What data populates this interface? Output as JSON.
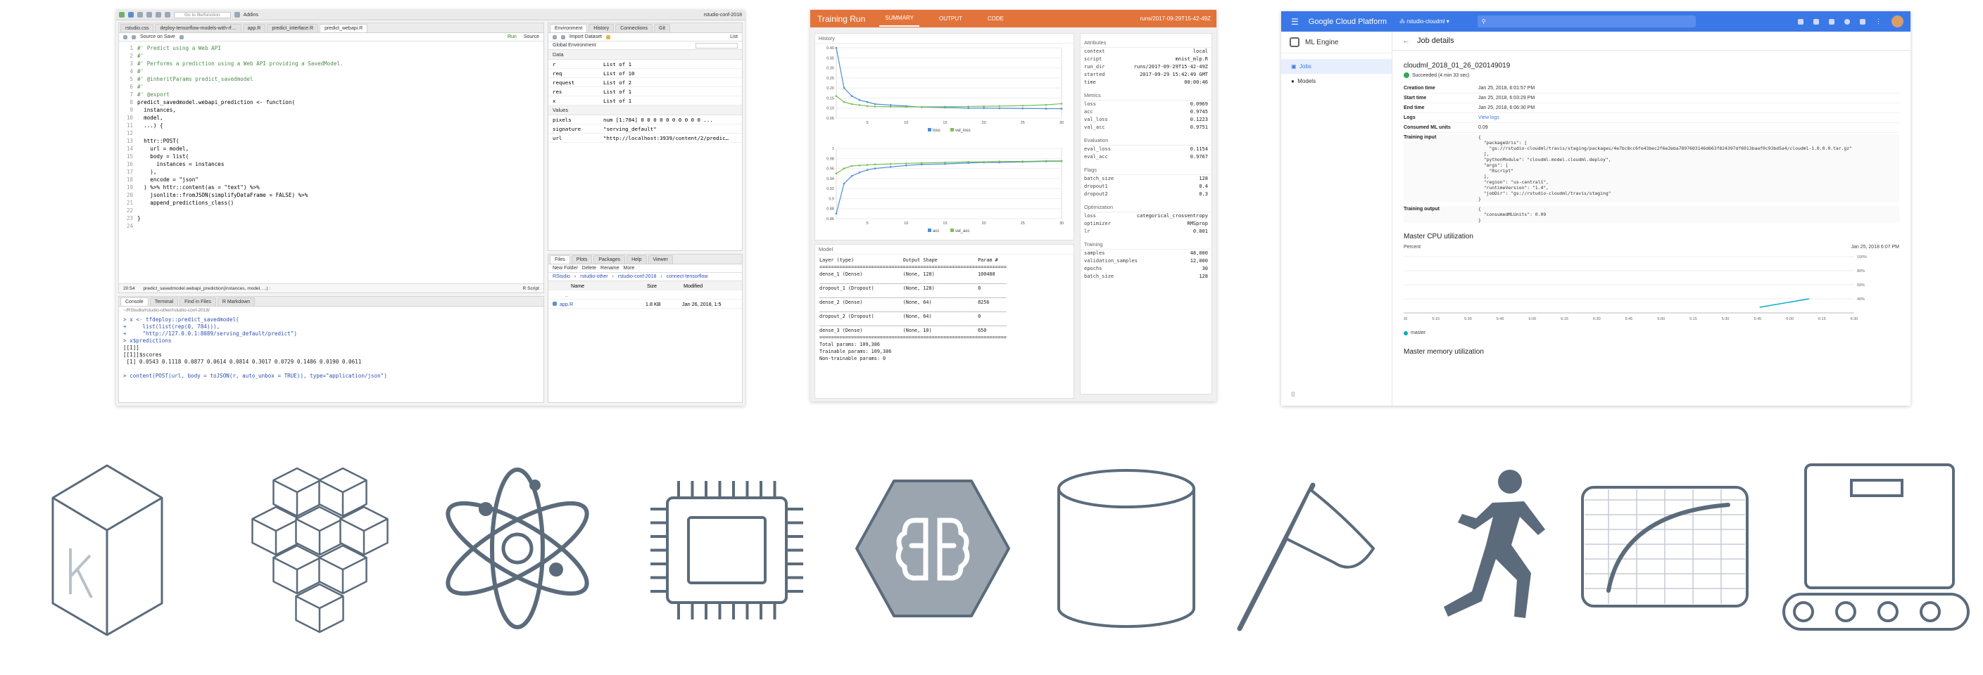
{
  "rstudio": {
    "toolbar": {
      "go_to_file": "Go to file/function",
      "addins": "Addins",
      "project": "rstudio-conf-2018"
    },
    "tabs": [
      "rstudio.css",
      "deploy-tensorflow-models-with-rf…",
      "app.R",
      "predict_interface.R",
      "predict_webapi.R"
    ],
    "source_on_save": "Source on Save",
    "run": "Run",
    "source": "Source",
    "code_lines": [
      [
        "1",
        "#' Predict using a Web API",
        "cm"
      ],
      [
        "2",
        "#'",
        "cm"
      ],
      [
        "3",
        "#' Performs a prediction using a Web API providing a SavedModel.",
        "cm"
      ],
      [
        "4",
        "#'",
        "cm"
      ],
      [
        "5",
        "#' @inheritParams predict_savedmodel",
        "cm"
      ],
      [
        "6",
        "#'",
        "cm"
      ],
      [
        "7",
        "#' @export",
        "cm"
      ],
      [
        "8",
        "predict_savedmodel.webapi_prediction <- function(",
        ""
      ],
      [
        "9",
        "  instances,",
        ""
      ],
      [
        "10",
        "  model,",
        ""
      ],
      [
        "11",
        "  ...) {",
        ""
      ],
      [
        "12",
        "",
        ""
      ],
      [
        "13",
        "  httr::POST(",
        ""
      ],
      [
        "14",
        "    url = model,",
        ""
      ],
      [
        "15",
        "    body = list(",
        ""
      ],
      [
        "16",
        "      instances = instances",
        ""
      ],
      [
        "17",
        "    ),",
        ""
      ],
      [
        "18",
        "    encode = \"json\"",
        ""
      ],
      [
        "19",
        "  ) %>% httr::content(as = \"text\") %>%",
        ""
      ],
      [
        "20",
        "    jsonlite::fromJSON(simplifyDataFrame = FALSE) %>%",
        ""
      ],
      [
        "21",
        "    append_predictions_class()",
        ""
      ],
      [
        "22",
        "",
        ""
      ],
      [
        "23",
        "}",
        ""
      ],
      [
        "24",
        "",
        ""
      ]
    ],
    "status_pos": "20:54",
    "status_fn": "predict_savedmodel.webapi_prediction(instances, model, ...) :",
    "status_lang": "R Script",
    "console_tabs": [
      "Console",
      "Terminal",
      "Find in Files",
      "R Markdown"
    ],
    "console_path": "~/RStudio/rstudio-other/rstudio-conf-2018/",
    "console_lines": [
      [
        "> ",
        "x <- tfdeploy::predict_savedmodel("
      ],
      [
        "+ ",
        "    list(list(rep(0, 784))),"
      ],
      [
        "+ ",
        "    \"http://127.0.0.1:8089/serving_default/predict\")"
      ],
      [
        "> ",
        "x$predictions"
      ],
      [
        "",
        "[[1]]"
      ],
      [
        "",
        "[[1]]$scores"
      ],
      [
        "",
        " [1] 0.0543 0.1118 0.0877 0.0614 0.0814 0.3017 0.0729 0.1486 0.0190 0.0611"
      ],
      [
        "",
        ""
      ],
      [
        "> ",
        "content(POST(url, body = toJSON(r, auto_unbox = TRUE)), type=\"application/json\")"
      ]
    ],
    "env_tabs": [
      "Environment",
      "History",
      "Connections",
      "Git"
    ],
    "import_dataset": "Import Dataset",
    "list": "List",
    "global_env": "Global Environment",
    "data_label": "Data",
    "data_rows": [
      [
        "r",
        "List of 1"
      ],
      [
        "req",
        "List of 10"
      ],
      [
        "request",
        "List of 2"
      ],
      [
        "res",
        "List of 1"
      ],
      [
        "x",
        "List of 1"
      ]
    ],
    "values_label": "Values",
    "value_rows": [
      [
        "pixels",
        "num [1:784] 0 0 0 0 0 0 0 0 0 0 ..."
      ],
      [
        "signature",
        "\"serving_default\""
      ],
      [
        "url",
        "\"http://localhost:3939/content/2/predic…"
      ]
    ],
    "files_tabs": [
      "Files",
      "Plots",
      "Packages",
      "Help",
      "Viewer"
    ],
    "files_toolbar": [
      "New Folder",
      "Delete",
      "Rename",
      "More"
    ],
    "files_path": [
      "RStudio",
      "rstudio-other",
      "rstudio-conf-2018",
      "connect-tensorflow"
    ],
    "files_cols": [
      "Name",
      "Size",
      "Modified"
    ],
    "files_rows": [
      [
        "..",
        "",
        ""
      ],
      [
        "app.R",
        "1.8 KB",
        "Jan 26, 2018, 1:5"
      ]
    ]
  },
  "training": {
    "title": "Training Run",
    "nav": [
      "SUMMARY",
      "OUTPUT",
      "CODE"
    ],
    "run_id": "runs/2017-09-29T15-42-49Z",
    "history_label": "History",
    "loss_yticks": [
      "0.40",
      "0.35",
      "0.30",
      "0.25",
      "0.20",
      "0.15",
      "0.10",
      "0.05"
    ],
    "acc_yticks": [
      "1",
      "0.98",
      "0.96",
      "0.94",
      "0.92",
      "0.9",
      "0.88",
      "0.86"
    ],
    "xticks": [
      "5",
      "10",
      "15",
      "20",
      "25",
      "30"
    ],
    "legend1": [
      "loss",
      "val_loss"
    ],
    "legend2": [
      "acc",
      "val_acc"
    ],
    "model_label": "Model",
    "model_text": "Layer (type)                 Output Shape              Param #\n=================================================================\ndense_1 (Dense)              (None, 128)               100480\n_________________________________________________________________\ndropout_1 (Dropout)          (None, 128)               0\n_________________________________________________________________\ndense_2 (Dense)              (None, 64)                8256\n_________________________________________________________________\ndropout_2 (Dropout)          (None, 64)                0\n_________________________________________________________________\ndense_3 (Dense)              (None, 10)                650\n=================================================================\nTotal params: 109,386\nTrainable params: 109,386\nNon-trainable params: 0",
    "attributes_label": "Attributes",
    "attributes": [
      [
        "context",
        "local"
      ],
      [
        "script",
        "mnist_mlp.R"
      ],
      [
        "run_dir",
        "runs/2017-09-29T15-42-49Z"
      ],
      [
        "started",
        "2017-09-29 15:42:49 GMT"
      ],
      [
        "time",
        "00:00:46"
      ]
    ],
    "metrics_label": "Metrics",
    "metrics": [
      [
        "loss",
        "0.0969"
      ],
      [
        "acc",
        "0.9745"
      ],
      [
        "val_loss",
        "0.1223"
      ],
      [
        "val_acc",
        "0.9751"
      ]
    ],
    "evaluation_label": "Evaluation",
    "evaluation": [
      [
        "eval_loss",
        "0.1154"
      ],
      [
        "eval_acc",
        "0.9767"
      ]
    ],
    "flags_label": "Flags",
    "flags": [
      [
        "batch_size",
        "128"
      ],
      [
        "dropout1",
        "0.4"
      ],
      [
        "dropout2",
        "0.3"
      ]
    ],
    "optimization_label": "Optimization",
    "optimization": [
      [
        "loss",
        "categorical_crossentropy"
      ],
      [
        "optimizer",
        "RMSprop"
      ],
      [
        "lr",
        "0.001"
      ]
    ],
    "training_label": "Training",
    "training": [
      [
        "samples",
        "48,000"
      ],
      [
        "validation_samples",
        "12,000"
      ],
      [
        "epochs",
        "30"
      ],
      [
        "batch_size",
        "128"
      ]
    ]
  },
  "chart_data": [
    {
      "type": "line",
      "title": "",
      "xlabel": "",
      "ylabel": "",
      "x": [
        1,
        2,
        3,
        4,
        5,
        6,
        8,
        10,
        12,
        15,
        18,
        20,
        22,
        25,
        28,
        30
      ],
      "ylim": [
        0.05,
        0.4
      ],
      "legend": "bottom",
      "series": [
        {
          "name": "loss",
          "values": [
            0.4,
            0.2,
            0.16,
            0.14,
            0.13,
            0.12,
            0.115,
            0.11,
            0.105,
            0.103,
            0.1,
            0.1,
            0.099,
            0.098,
            0.097,
            0.097
          ]
        },
        {
          "name": "val_loss",
          "values": [
            0.16,
            0.13,
            0.12,
            0.115,
            0.11,
            0.108,
            0.107,
            0.106,
            0.106,
            0.107,
            0.108,
            0.109,
            0.11,
            0.112,
            0.116,
            0.122
          ]
        }
      ]
    },
    {
      "type": "line",
      "title": "",
      "xlabel": "",
      "ylabel": "",
      "x": [
        1,
        2,
        3,
        4,
        5,
        6,
        8,
        10,
        12,
        15,
        18,
        20,
        22,
        25,
        28,
        30
      ],
      "ylim": [
        0.86,
        1.0
      ],
      "legend": "bottom",
      "series": [
        {
          "name": "acc",
          "values": [
            0.87,
            0.93,
            0.945,
            0.952,
            0.957,
            0.96,
            0.963,
            0.966,
            0.968,
            0.969,
            0.971,
            0.972,
            0.972,
            0.973,
            0.974,
            0.9745
          ]
        },
        {
          "name": "val_acc",
          "values": [
            0.95,
            0.96,
            0.965,
            0.966,
            0.967,
            0.968,
            0.969,
            0.97,
            0.971,
            0.972,
            0.973,
            0.973,
            0.974,
            0.974,
            0.975,
            0.9751
          ]
        }
      ]
    }
  ],
  "gcp": {
    "brand": "Google Cloud Platform",
    "project": "rstudio-cloudml",
    "product": "ML Engine",
    "nav": [
      "Jobs",
      "Models"
    ],
    "page_title": "Job details",
    "job_id": "cloudml_2018_01_26_020149019",
    "status": "Succeeded (4 min 33 sec)",
    "details": [
      [
        "Creation time",
        "Jan 25, 2018, 6:01:57 PM"
      ],
      [
        "Start time",
        "Jan 25, 2018, 6:03:29 PM"
      ],
      [
        "End time",
        "Jan 25, 2018, 6:06:30 PM"
      ],
      [
        "Logs",
        "View logs"
      ],
      [
        "Consumed ML units",
        "0.09"
      ]
    ],
    "training_input_label": "Training input",
    "training_input": "{\n  \"packageUris\": [\n    \"gs://rstudio-cloudml/travis/staging/packages/4e7bc8cc6fe43bec2f6e2eba7897603146d663f824397df6913baaf0c93bd5a4/cloudml-1.0.0.0.tar.gz\"\n  ],\n  \"pythonModule\": \"cloudml.model.cloudml.deploy\",\n  \"args\": [\n    \"Rscript\"\n  ],\n  \"region\": \"us-central1\",\n  \"runtimeVersion\": \"1.4\",\n  \"jobDir\": \"gs://rstudio-cloudml/travis/staging\"\n}",
    "training_output_label": "Training output",
    "training_output": "{\n  \"consumedMLUnits\": 0.09\n}",
    "cpu_title": "Master CPU utilization",
    "cpu_unit": "Percent",
    "cpu_time": "Jan 25, 2018 6:07 PM",
    "cpu_yticks": [
      "100%",
      "80%",
      "60%",
      "40%"
    ],
    "cpu_xticks": [
      "5:00",
      "5:15",
      "5:30",
      "5:45",
      "6:00",
      "6:15",
      "6:30",
      "6:45",
      "5:00",
      "5:15",
      "5:30",
      "5:45",
      "6:00",
      "6:15",
      "6:30"
    ],
    "cpu_legend": "master",
    "mem_title": "Master memory utilization"
  },
  "icons": [
    "keras-icon",
    "cubes-icon",
    "atom-icon",
    "cpu-chip-icon",
    "brain-hexagon-icon",
    "database-cylinder-icon",
    "flag-icon",
    "runner-icon",
    "spreadsheet-curve-icon",
    "conveyor-box-icon"
  ],
  "colors": {
    "training_orange": "#e2733a",
    "gcp_blue": "#3b78e7",
    "icon_gray": "#5b6b7b",
    "series_blue": "#4a8fd8",
    "series_green": "#7bbf5a"
  }
}
